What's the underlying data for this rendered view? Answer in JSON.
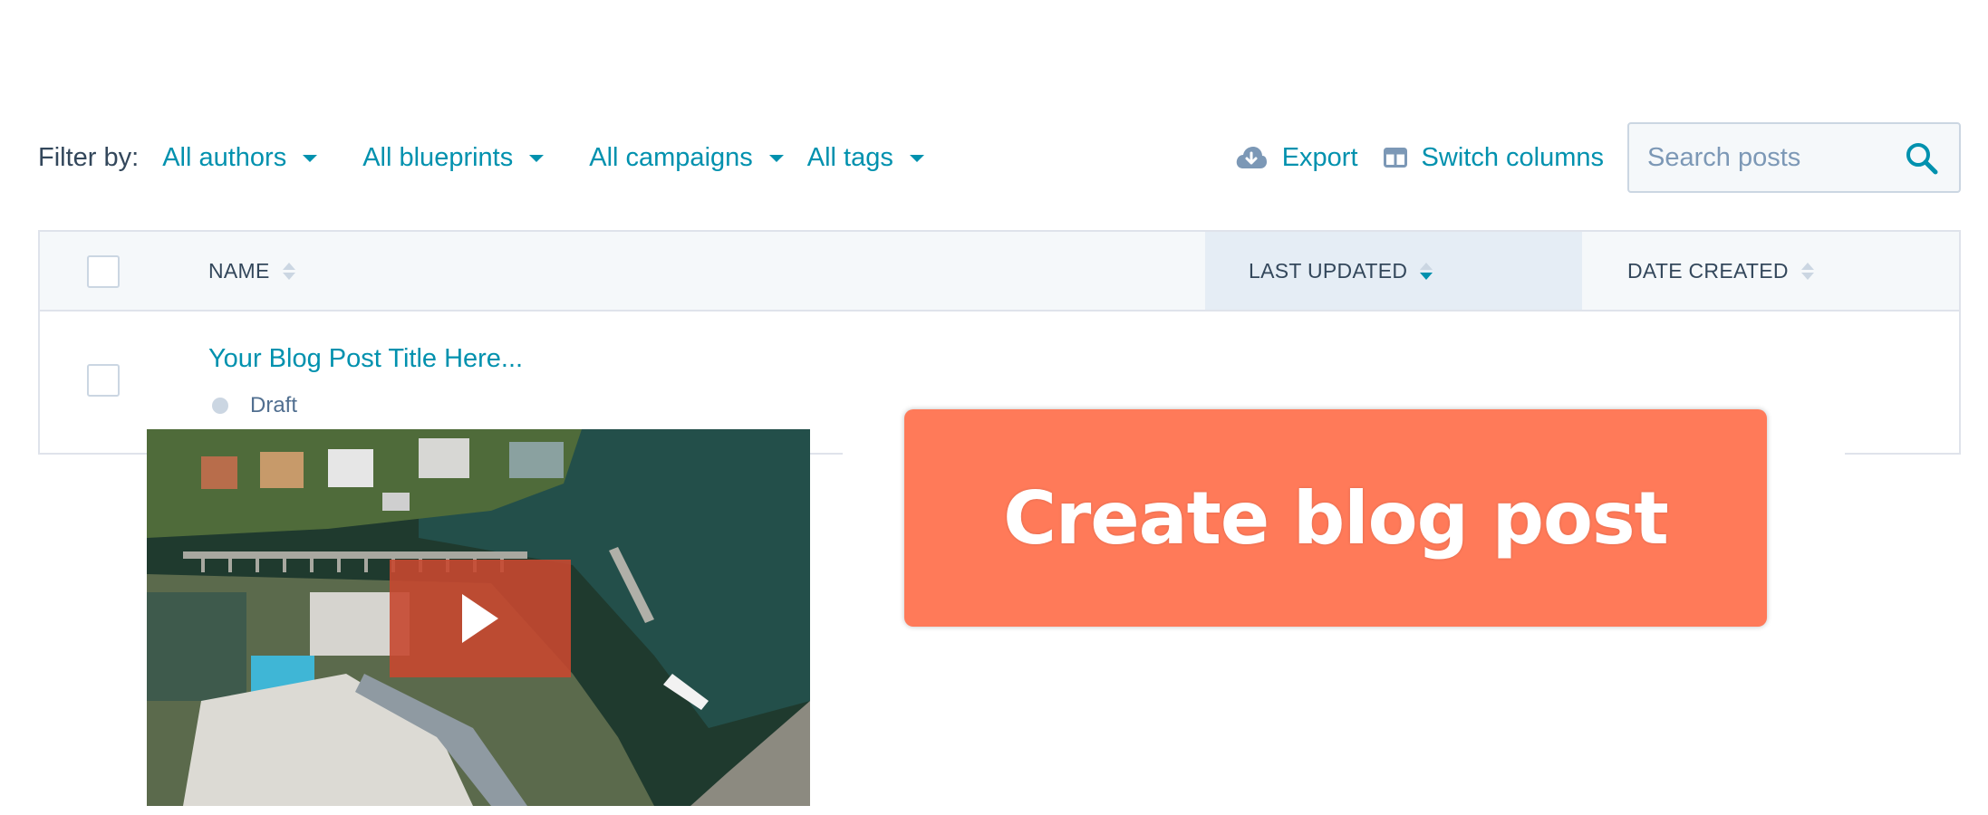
{
  "filters": {
    "label": "Filter by:",
    "authors": "All authors",
    "blueprints": "All blueprints",
    "campaigns": "All campaigns",
    "tags": "All tags"
  },
  "toolbar": {
    "export_label": "Export",
    "switch_columns_label": "Switch columns",
    "export_icon": "cloud-download-icon",
    "switch_columns_icon": "columns-icon"
  },
  "search": {
    "placeholder": "Search posts",
    "value": "",
    "icon": "search-icon"
  },
  "table": {
    "columns": [
      {
        "label": "NAME",
        "sort": "none"
      },
      {
        "label": "LAST UPDATED",
        "sort": "descending"
      },
      {
        "label": "DATE CREATED",
        "sort": "none"
      }
    ],
    "rows": [
      {
        "title": "Your Blog Post Title Here...",
        "status": "Draft"
      }
    ]
  },
  "video": {
    "icon": "play-icon"
  },
  "cta": {
    "label": "Create blog post"
  },
  "colors": {
    "link": "#0091ae",
    "text": "#33475b",
    "cta": "#ff7a59",
    "play_button": "#c74830",
    "header_bg": "#f5f8fa",
    "sorted_header_bg": "#e5edf5"
  }
}
